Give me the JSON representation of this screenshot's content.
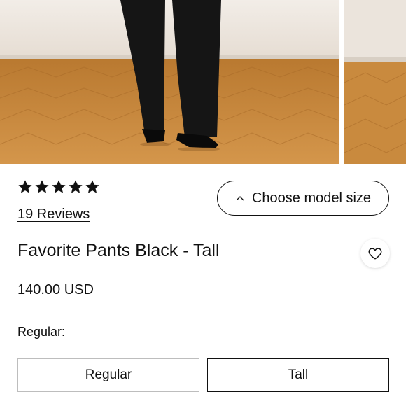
{
  "gallery": {
    "images": [
      {
        "icon": "product-photo-model-black-pants-herringbone-floor"
      },
      {
        "icon": "product-photo-partial-next"
      }
    ]
  },
  "rating": {
    "stars_filled": 5,
    "stars_total": 5,
    "reviews_label": "19 Reviews"
  },
  "model_size": {
    "label": "Choose model size",
    "icon": "chevron-up-icon"
  },
  "product": {
    "title": "Favorite Pants Black - Tall",
    "price": "140.00 USD",
    "wishlist_icon": "heart-icon"
  },
  "variant": {
    "label": "Regular:",
    "options": [
      {
        "label": "Regular",
        "selected": false
      },
      {
        "label": "Tall",
        "selected": true
      }
    ]
  },
  "colors": {
    "text": "#111111",
    "floor": "#c98a3e",
    "wall": "#ebe4dc"
  }
}
